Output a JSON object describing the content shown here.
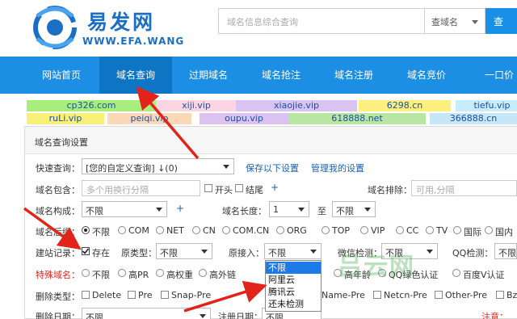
{
  "header": {
    "logo_cn": "易发网",
    "logo_en": "WWW.EFA.WANG",
    "search_placeholder": "域名信息综合查询",
    "search_type": "查域名",
    "search_button": "查"
  },
  "nav": {
    "items": [
      "网站首页",
      "域名查询",
      "过期域名",
      "域名抢注",
      "域名注册",
      "域名竞价",
      "一口价"
    ],
    "active_index": 1
  },
  "tags": {
    "row1": [
      "cp326.com",
      "xiji.vip",
      "xiaojie.vip",
      "6298.cn",
      "tiefu.vip"
    ],
    "row2": [
      "ruLi.vip",
      "peiqi.vip",
      "oupu.vip",
      "618888.net",
      "366888.cn"
    ]
  },
  "panel": {
    "title": "域名查询设置",
    "quick_query_label": "快速查询：",
    "quick_query_value": "[您的自定义查询] ↓(0)",
    "save_settings": "保存以下设置",
    "manage_settings": "管理我的设置",
    "contains_label": "域名包含：",
    "contains_placeholder": "多个用换行分隔",
    "starts_label": "开头",
    "ends_label": "结尾",
    "plus": "+",
    "exclude_label": "域名排除：",
    "exclude_placeholder": "可用,分隔",
    "structure_label": "域名构成：",
    "structure_value": "不限",
    "length_label": "域名长度：",
    "length_value": "1",
    "to_label": "至",
    "length_to_value": "不限",
    "suffix_label": "域名后缀：",
    "suffixes": [
      "不限",
      "COM",
      "NET",
      "CN",
      "COM.CN",
      "ORG",
      "TOP",
      "VIP",
      "CC",
      "TV",
      "国际",
      "国内"
    ],
    "site_label": "建站记录：",
    "site_checkbox": "存在",
    "origin_type_label": "原类型：",
    "origin_type_value": "不限",
    "origin_access_label": "原接入：",
    "origin_access_value": "不限",
    "wechat_label": "微信检测：",
    "wechat_value": "不限",
    "qq_label": "QQ检测：",
    "qq_value": "不限",
    "special_label": "特殊域名：",
    "special_options": [
      "不限",
      "高PR",
      "高权重",
      "高外链",
      "高年龄",
      "QQ绿色认证",
      "百度V认证"
    ],
    "delete_type_label": "删除类型：",
    "delete_types": [
      "Delete",
      "Pre",
      "Snap-Pre",
      "Name-Pre",
      "Netcn-Pre",
      "Other-Pre",
      "Bz-"
    ],
    "delete_date_label": "删除日期：",
    "delete_date_value": "不限",
    "reg_date_label": "注册日期：",
    "reg_date_value": "不限",
    "note": "注意："
  },
  "dropdown": {
    "items": [
      "不限",
      "阿里云",
      "腾讯云",
      "还未检测"
    ],
    "selected_index": 0
  },
  "watermark": "吕云网",
  "colors": {
    "nav_blue": "#1c8ee4",
    "nav_active": "#0e74c4",
    "annotation_red": "#e2231a",
    "dropdown_highlight": "#1e7ae8"
  }
}
